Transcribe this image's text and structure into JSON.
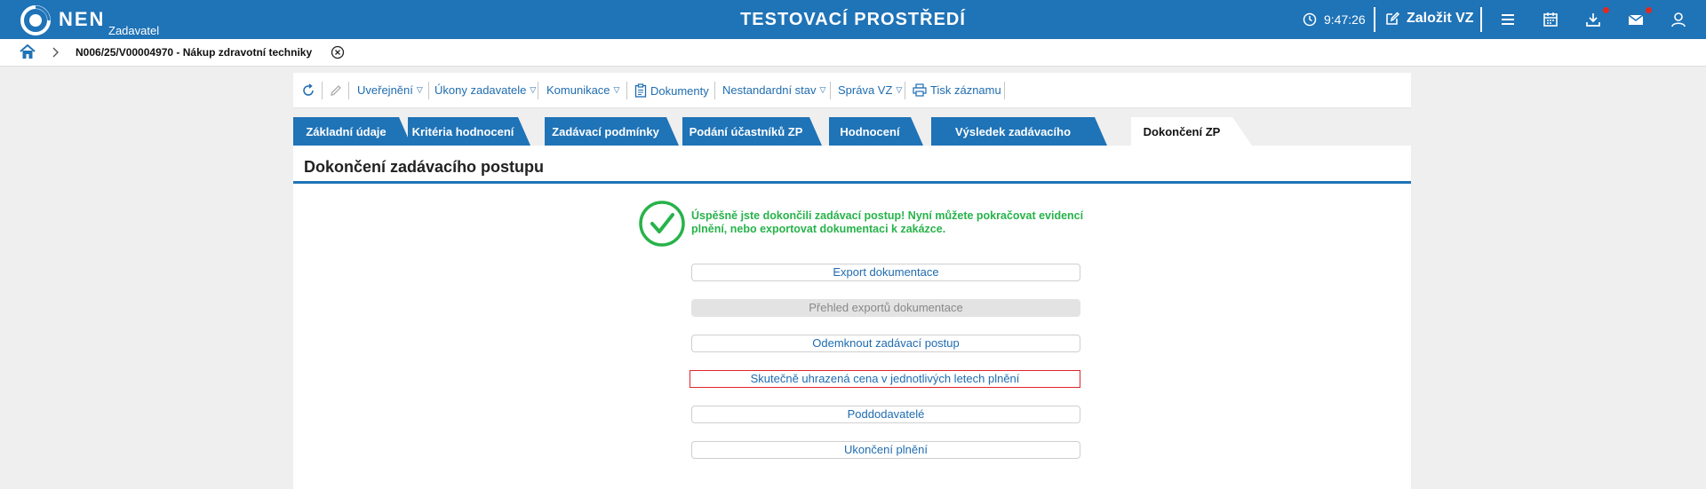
{
  "header": {
    "brand": "NEN",
    "brand_sub": "Zadavatel",
    "env_title": "TESTOVACÍ PROSTŘEDÍ",
    "time": "9:47:26",
    "new_vz": "Založit VZ"
  },
  "breadcrumb": {
    "current": "N006/25/V00004970 - Nákup zdravotní techniky"
  },
  "toolbar": {
    "uverejneni": "Uveřejnění",
    "ukony": "Úkony zadavatele",
    "komunikace": "Komunikace",
    "dokumenty": "Dokumenty",
    "nestandardni": "Nestandardní stav",
    "sprava": "Správa VZ",
    "tisk": "Tisk záznamu"
  },
  "tabs": [
    {
      "label": "Základní údaje"
    },
    {
      "label": "Kritéria hodnocení"
    },
    {
      "label": "Zadávací podmínky"
    },
    {
      "label": "Podání účastníků ZP"
    },
    {
      "label": "Hodnocení"
    },
    {
      "label": "Výsledek zadávacího postupu"
    },
    {
      "label": "Dokončení ZP"
    }
  ],
  "main": {
    "title": "Dokončení zadávacího postupu",
    "success_message": "Úspěšně jste dokončili zadávací postup! Nyní můžete pokračovat evidencí plnění, nebo exportovat dokumentaci k zakázce.",
    "actions": [
      {
        "label": "Export dokumentace"
      },
      {
        "label": "Přehled exportů dokumentace"
      },
      {
        "label": "Odemknout zadávací postup"
      },
      {
        "label": "Skutečně uhrazená cena v jednotlivých letech plnění"
      },
      {
        "label": "Poddodavatelé"
      },
      {
        "label": "Ukončení plnění"
      }
    ]
  },
  "colors": {
    "primary": "#1f73b7",
    "success": "#27b34a",
    "highlight": "#e0262b"
  }
}
